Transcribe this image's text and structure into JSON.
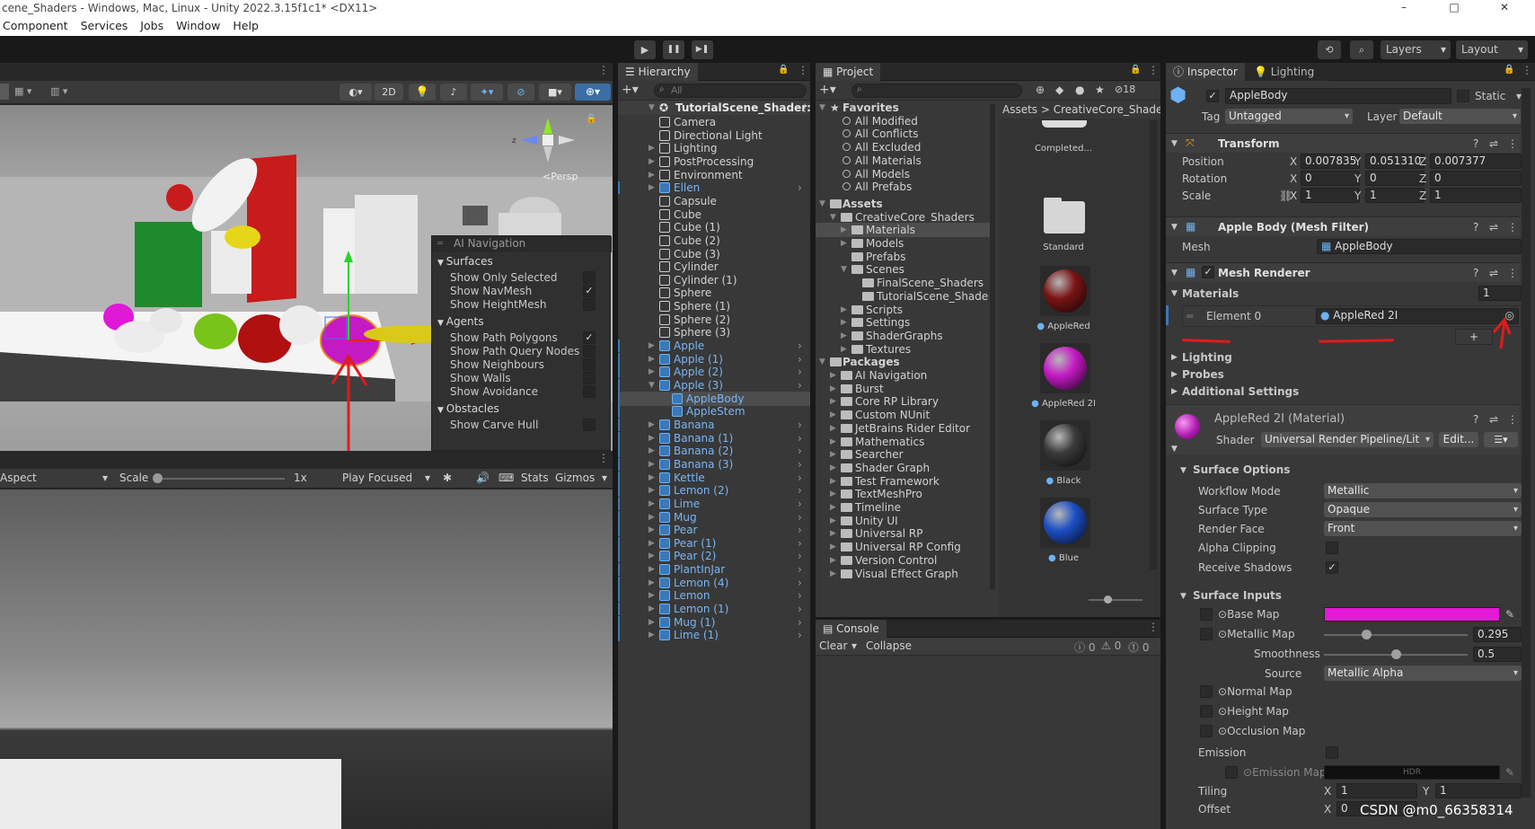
{
  "window": {
    "title": "cene_Shaders - Windows, Mac, Linux - Unity 2022.3.15f1c1* <DX11>",
    "controls": [
      "–",
      "□",
      "✕"
    ]
  },
  "menu": [
    "Component",
    "Services",
    "Jobs",
    "Window",
    "Help"
  ],
  "toolbar": {
    "play": "▶",
    "pause": "❚❚",
    "step": "▶❚",
    "layers": "Layers",
    "layout": "Layout"
  },
  "scene": {
    "toolbar_2d": "2D",
    "persp_label": "<Persp",
    "overlay": {
      "title": "AI Navigation",
      "sections": [
        {
          "name": "Surfaces",
          "items": [
            {
              "label": "Show Only Selected",
              "checked": false
            },
            {
              "label": "Show NavMesh",
              "checked": true
            },
            {
              "label": "Show HeightMesh",
              "checked": false
            }
          ]
        },
        {
          "name": "Agents",
          "items": [
            {
              "label": "Show Path Polygons",
              "checked": true
            },
            {
              "label": "Show Path Query Nodes",
              "checked": false
            },
            {
              "label": "Show Neighbours",
              "checked": false
            },
            {
              "label": "Show Walls",
              "checked": false
            },
            {
              "label": "Show Avoidance",
              "checked": false
            }
          ]
        },
        {
          "name": "Obstacles",
          "items": [
            {
              "label": "Show Carve Hull",
              "checked": false
            }
          ]
        }
      ]
    }
  },
  "game": {
    "aspect": "Aspect",
    "scale_label": "Scale",
    "scale_value": "1x",
    "play_focused": "Play Focused",
    "stats": "Stats",
    "gizmos": "Gizmos"
  },
  "hierarchy": {
    "tab": "Hierarchy",
    "search_placeholder": "All",
    "scene_name": "TutorialScene_Shader:",
    "items": [
      {
        "label": "Camera",
        "prefab": false,
        "fold": false
      },
      {
        "label": "Directional Light",
        "prefab": false,
        "fold": false
      },
      {
        "label": "Lighting",
        "prefab": false,
        "fold": true
      },
      {
        "label": "PostProcessing",
        "prefab": false,
        "fold": true
      },
      {
        "label": "Environment",
        "prefab": false,
        "fold": true
      },
      {
        "label": "Ellen",
        "prefab": true,
        "fold": true
      },
      {
        "label": "Capsule",
        "prefab": false,
        "fold": false
      },
      {
        "label": "Cube",
        "prefab": false,
        "fold": false
      },
      {
        "label": "Cube (1)",
        "prefab": false,
        "fold": false
      },
      {
        "label": "Cube (2)",
        "prefab": false,
        "fold": false
      },
      {
        "label": "Cube (3)",
        "prefab": false,
        "fold": false
      },
      {
        "label": "Cylinder",
        "prefab": false,
        "fold": false
      },
      {
        "label": "Cylinder (1)",
        "prefab": false,
        "fold": false
      },
      {
        "label": "Sphere",
        "prefab": false,
        "fold": false
      },
      {
        "label": "Sphere (1)",
        "prefab": false,
        "fold": false
      },
      {
        "label": "Sphere (2)",
        "prefab": false,
        "fold": false
      },
      {
        "label": "Sphere (3)",
        "prefab": false,
        "fold": false
      },
      {
        "label": "Apple",
        "prefab": true,
        "fold": true
      },
      {
        "label": "Apple (1)",
        "prefab": true,
        "fold": true
      },
      {
        "label": "Apple (2)",
        "prefab": true,
        "fold": true
      },
      {
        "label": "Apple (3)",
        "prefab": true,
        "fold": "open"
      },
      {
        "label": "AppleBody",
        "prefab": true,
        "child": true,
        "selected": true
      },
      {
        "label": "AppleStem",
        "prefab": true,
        "child": true
      },
      {
        "label": "Banana",
        "prefab": true,
        "fold": true
      },
      {
        "label": "Banana (1)",
        "prefab": true,
        "fold": true
      },
      {
        "label": "Banana (2)",
        "prefab": true,
        "fold": true
      },
      {
        "label": "Banana (3)",
        "prefab": true,
        "fold": true
      },
      {
        "label": "Kettle",
        "prefab": true,
        "fold": true
      },
      {
        "label": "Lemon (2)",
        "prefab": true,
        "fold": true
      },
      {
        "label": "Lime",
        "prefab": true,
        "fold": true
      },
      {
        "label": "Mug",
        "prefab": true,
        "fold": true
      },
      {
        "label": "Pear",
        "prefab": true,
        "fold": true
      },
      {
        "label": "Pear (1)",
        "prefab": true,
        "fold": true
      },
      {
        "label": "Pear (2)",
        "prefab": true,
        "fold": true
      },
      {
        "label": "PlantInJar",
        "prefab": true,
        "fold": true
      },
      {
        "label": "Lemon (4)",
        "prefab": true,
        "fold": true
      },
      {
        "label": "Lemon",
        "prefab": true,
        "fold": true
      },
      {
        "label": "Lemon (1)",
        "prefab": true,
        "fold": true
      },
      {
        "label": "Mug (1)",
        "prefab": true,
        "fold": true
      },
      {
        "label": "Lime (1)",
        "prefab": true,
        "fold": true
      }
    ]
  },
  "project": {
    "tab": "Project",
    "hidden_count": "18",
    "breadcrumb": [
      "Assets",
      "CreativeCore_Shaders"
    ],
    "favorites_label": "Favorites",
    "favorites": [
      "All Modified",
      "All Conflicts",
      "All Excluded",
      "All Materials",
      "All Models",
      "All Prefabs"
    ],
    "assets_label": "Assets",
    "tree": [
      {
        "label": "CreativeCore_Shaders",
        "depth": 1,
        "fold": "open"
      },
      {
        "label": "Materials",
        "depth": 2,
        "fold": true,
        "selected": true
      },
      {
        "label": "Models",
        "depth": 2,
        "fold": true
      },
      {
        "label": "Prefabs",
        "depth": 2,
        "fold": false
      },
      {
        "label": "Scenes",
        "depth": 2,
        "fold": "open"
      },
      {
        "label": "FinalScene_Shaders",
        "depth": 3,
        "fold": false
      },
      {
        "label": "TutorialScene_Shade",
        "depth": 3,
        "fold": false
      },
      {
        "label": "Scripts",
        "depth": 2,
        "fold": true
      },
      {
        "label": "Settings",
        "depth": 2,
        "fold": true
      },
      {
        "label": "ShaderGraphs",
        "depth": 2,
        "fold": true
      },
      {
        "label": "Textures",
        "depth": 2,
        "fold": true
      }
    ],
    "packages_label": "Packages",
    "packages": [
      "AI Navigation",
      "Burst",
      "Core RP Library",
      "Custom NUnit",
      "JetBrains Rider Editor",
      "Mathematics",
      "Searcher",
      "Shader Graph",
      "Test Framework",
      "TextMeshPro",
      "Timeline",
      "Unity UI",
      "Universal RP",
      "Universal RP Config",
      "Version Control",
      "Visual Effect Graph"
    ],
    "grid": [
      {
        "label": "Completed...",
        "kind": "partial"
      },
      {
        "label": "Standard",
        "kind": "folder"
      },
      {
        "label": "AppleRed",
        "kind": "sphere",
        "color": "#7a1414"
      },
      {
        "label": "AppleRed 2I",
        "kind": "sphere",
        "color": "#c41ac4"
      },
      {
        "label": "Black",
        "kind": "sphere",
        "color": "#3a3a3a"
      },
      {
        "label": "Blue",
        "kind": "sphere",
        "color": "#1d4fc4"
      }
    ]
  },
  "console": {
    "tab": "Console",
    "clear": "Clear",
    "collapse": "Collapse",
    "counts": [
      "0",
      "0",
      "0"
    ]
  },
  "inspector": {
    "tabs": [
      "Inspector",
      "Lighting"
    ],
    "object_name": "AppleBody",
    "static_label": "Static",
    "tag_label": "Tag",
    "tag_value": "Untagged",
    "layer_label": "Layer",
    "layer_value": "Default",
    "transform": {
      "title": "Transform",
      "rows": [
        {
          "label": "Position",
          "x": "0.007835",
          "y": "0.051310",
          "z": "0.007377"
        },
        {
          "label": "Rotation",
          "x": "0",
          "y": "0",
          "z": "0"
        },
        {
          "label": "Scale",
          "x": "1",
          "y": "1",
          "z": "1"
        }
      ]
    },
    "mesh_filter": {
      "title": "Apple Body (Mesh Filter)",
      "mesh_label": "Mesh",
      "mesh_value": "AppleBody"
    },
    "mesh_renderer": {
      "title": "Mesh Renderer",
      "materials_label": "Materials",
      "materials_count": "1",
      "element_label": "Element 0",
      "element_value": "AppleRed 2I",
      "plus": "+",
      "sections": [
        "Lighting",
        "Probes",
        "Additional Settings"
      ]
    },
    "material": {
      "title": "AppleRed 2I (Material)",
      "shader_label": "Shader",
      "shader_value": "Universal Render Pipeline/Lit",
      "edit": "Edit...",
      "surface_options": "Surface Options",
      "options": [
        {
          "label": "Workflow Mode",
          "value": "Metallic"
        },
        {
          "label": "Surface Type",
          "value": "Opaque"
        },
        {
          "label": "Render Face",
          "value": "Front"
        }
      ],
      "alpha_clipping": "Alpha Clipping",
      "receive_shadows": "Receive Shadows",
      "surface_inputs": "Surface Inputs",
      "base_map": "Base Map",
      "base_color": "#e619d6",
      "metallic_map": "Metallic Map",
      "metallic_value": "0.295",
      "metallic_fraction": 0.295,
      "smoothness": "Smoothness",
      "smoothness_value": "0.5",
      "smoothness_fraction": 0.5,
      "source": "Source",
      "source_value": "Metallic Alpha",
      "normal_map": "Normal Map",
      "height_map": "Height Map",
      "occlusion_map": "Occlusion Map",
      "emission": "Emission",
      "emission_map": "Emission Map",
      "hdr": "HDR",
      "tiling": "Tiling",
      "tiling_x": "1",
      "tiling_y": "1",
      "offset": "Offset",
      "offset_x": "0"
    }
  },
  "watermark": "CSDN @m0_66358314"
}
